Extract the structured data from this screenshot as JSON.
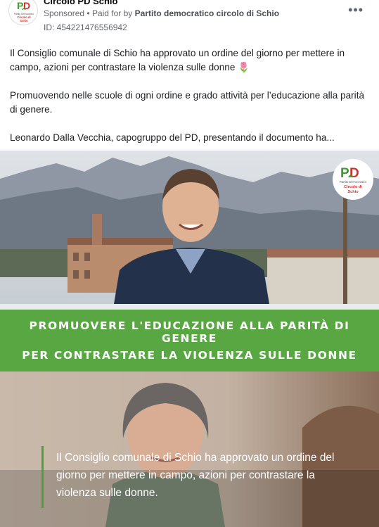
{
  "header": {
    "page_name": "Circolo PD Schio",
    "sponsored": "Sponsored",
    "paid_for_prefix": "Paid for by",
    "paid_for_name": "Partito democratico circolo di Schio",
    "ad_id": "ID: 454221476556942",
    "avatar_logo": {
      "main": "PD",
      "line1": "Partito Democratico",
      "line2": "Circolo di",
      "line3": "Schio"
    }
  },
  "body": {
    "paragraph_1": "Il Consiglio comunale di Schio ha approvato un ordine del giorno per mettere in campo, azioni per contrastare la violenza sulle donne 🌷",
    "paragraph_2": "Promuovendo nelle scuole di ogni ordine e grado attività per l’educazione alla parità di genere.",
    "paragraph_3": "Leonardo Dalla Vecchia, capogruppo del PD, presentando il documento ha..."
  },
  "creative": {
    "banner_line_1": "PROMUOVERE L'EDUCAZIONE ALLA PARITÀ DI GENERE",
    "banner_line_2": "PER CONTRASTARE LA VIOLENZA SULLE DONNE",
    "quote": "Il Consiglio comunale di Schio ha approvato un ordine del giorno per mettere in campo, azioni per contrastare la violenza sulle donne.",
    "logo": {
      "main": "PD",
      "line1": "Partito Democratico",
      "line2": "Circolo di",
      "line3": "Schio"
    }
  },
  "colors": {
    "brand_green": "#58a742",
    "brand_red": "#d32f2f",
    "text": "#1c1e21",
    "muted": "#65676b"
  },
  "icons": {
    "more": "more-horizontal-icon"
  }
}
